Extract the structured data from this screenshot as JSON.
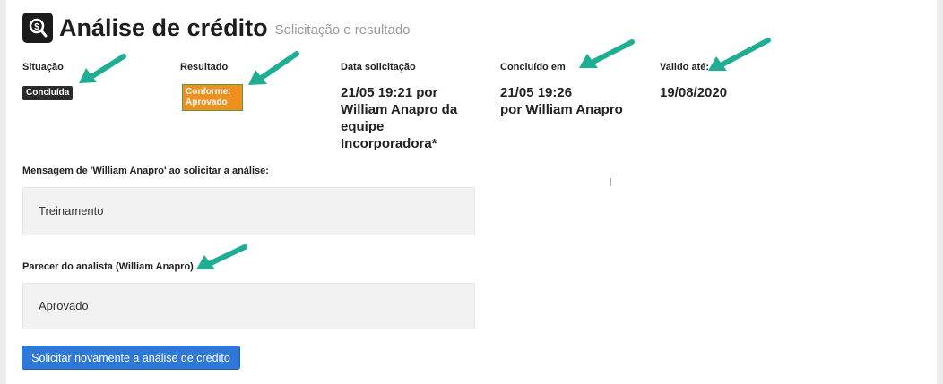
{
  "header": {
    "title": "Análise de crédito",
    "subtitle": "Solicitação e resultado",
    "icon": "search-document-icon"
  },
  "fields": {
    "situacao": {
      "label": "Situação",
      "value": "Concluída"
    },
    "resultado": {
      "label": "Resultado",
      "value_line1": "Conforme:",
      "value_line2": "Aprovado"
    },
    "data_solicitacao": {
      "label": "Data solicitação",
      "lines": [
        "21/05 19:21 por",
        "William Anapro da",
        "equipe",
        "Incorporadora*"
      ]
    },
    "concluido_em": {
      "label": "Concluído em",
      "lines": [
        "21/05 19:26",
        "por William Anapro"
      ]
    },
    "valido_ate": {
      "label": "Valido até:",
      "value": "19/08/2020"
    }
  },
  "mensagem": {
    "label": "Mensagem de 'William Anapro' ao solicitar a análise:",
    "value": "Treinamento"
  },
  "parecer": {
    "label": "Parecer do analista (William Anapro)",
    "value": "Aprovado"
  },
  "actions": {
    "solicitar_label": "Solicitar novamente a análise de crédito"
  },
  "colors": {
    "badge_dark": "#2b2b2b",
    "badge_orange": "#ef8f1f",
    "button_blue": "#2f78d6",
    "arrow_teal": "#1fae94"
  }
}
